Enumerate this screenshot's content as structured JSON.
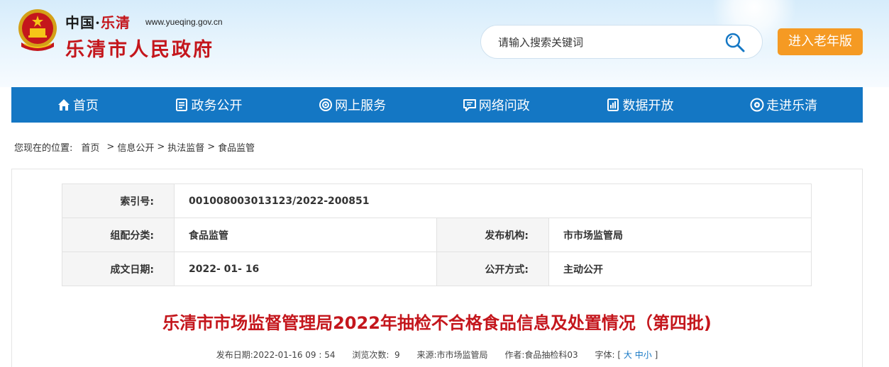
{
  "header": {
    "site_name_prefix": "中国·",
    "site_name_city": "乐清",
    "site_url": "www.yueqing.gov.cn",
    "site_name_main": "乐清市人民政府",
    "search_placeholder": "请输入搜索关键词",
    "elder_mode_label": "进入老年版"
  },
  "nav": {
    "items": [
      {
        "label": "首页",
        "icon": "home-icon"
      },
      {
        "label": "政务公开",
        "icon": "document-icon"
      },
      {
        "label": "网上服务",
        "icon": "service-icon"
      },
      {
        "label": "网络问政",
        "icon": "chat-icon"
      },
      {
        "label": "数据开放",
        "icon": "data-icon"
      },
      {
        "label": "走进乐清",
        "icon": "eye-icon"
      }
    ]
  },
  "breadcrumb": {
    "prefix": "您现在的位置:",
    "items": [
      "首页",
      "信息公开",
      "执法监督",
      "食品监管"
    ]
  },
  "meta": {
    "index_label": "索引号:",
    "index_value": "001008003013123/2022-200851",
    "category_label": "组配分类:",
    "category_value": "食品监管",
    "publisher_label": "发布机构:",
    "publisher_value": "市市场监管局",
    "date_label": "成文日期:",
    "date_value": "2022- 01- 16",
    "disclosure_label": "公开方式:",
    "disclosure_value": "主动公开"
  },
  "article": {
    "title": "乐清市市场监督管理局2022年抽检不合格食品信息及处置情况（第四批)",
    "publish_date_label": "发布日期:",
    "publish_date_value": "2022-01-16 09 : 54",
    "views_label": "浏览次数:",
    "views_value": "9",
    "source_label": "来源:",
    "source_value": "市市场监管局",
    "author_label": "作者:",
    "author_value": "食品抽检科03",
    "font_label": "字体:",
    "font_open": "[",
    "font_large": "大",
    "font_medium": "中",
    "font_small": "小",
    "font_close": "]"
  },
  "colors": {
    "nav_bg": "#1477c4",
    "accent_red": "#c4161c",
    "elder_btn": "#f59a23"
  }
}
